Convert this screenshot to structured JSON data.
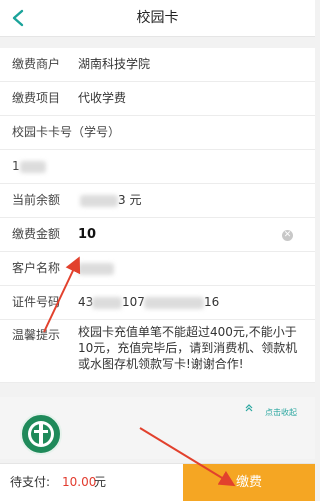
{
  "header": {
    "title": "校园卡",
    "back_icon": "chevron-left-icon",
    "accent": "#1aa39a"
  },
  "form": {
    "merchant": {
      "label": "缴费商户",
      "value": "湖南科技学院"
    },
    "item": {
      "label": "缴费项目",
      "value": "代收学费"
    },
    "card_no": {
      "label": "校园卡卡号（学号）",
      "value": "1"
    },
    "balance": {
      "label": "当前余额",
      "value_suffix": "3 元"
    },
    "amount": {
      "label": "缴费金额",
      "value": "10"
    },
    "customer": {
      "label": "客户名称",
      "value": ""
    },
    "id_no": {
      "label": "证件号码",
      "value_prefix": "43",
      "value_mid": "107",
      "value_suffix": "16"
    },
    "tip": {
      "label": "温馨提示",
      "text": "校园卡充值单笔不能超过400元,不能小于10元，充值完毕后，请到消费机、领款机或水图存机领款写卡!谢谢合作!"
    }
  },
  "collapse": {
    "label": "点击收起",
    "icon": "double-chevron-up-icon"
  },
  "footer": {
    "due_label": "待支付:",
    "due_amount": "10.00",
    "due_unit": "元",
    "pay_label": "缴费",
    "pay_color": "#f5a623"
  },
  "colors": {
    "amount_red": "#e23b2e",
    "arrow_red": "#e2412d"
  }
}
